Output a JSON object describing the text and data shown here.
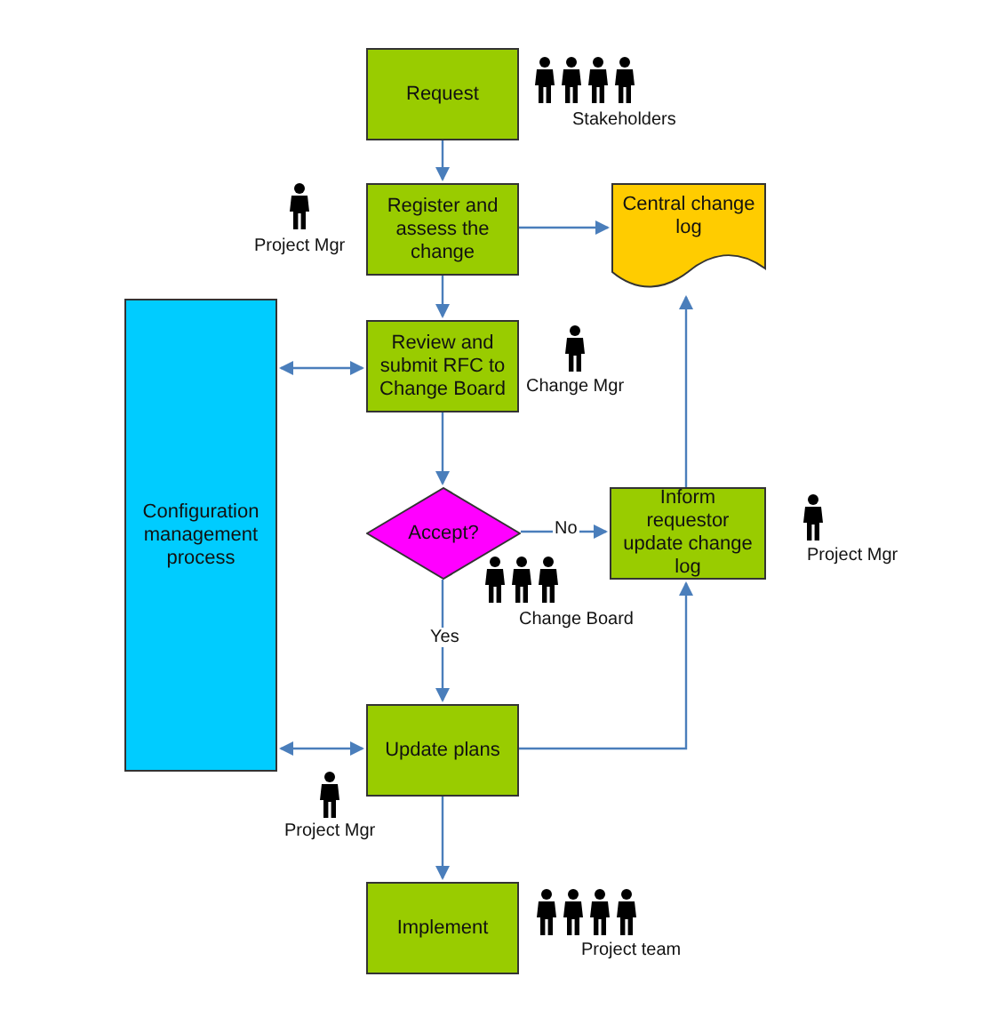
{
  "nodes": [
    {
      "kind": "process",
      "text": "Request"
    },
    {
      "kind": "process",
      "text": "Register and assess the change"
    },
    {
      "kind": "document",
      "text": "Central change log"
    },
    {
      "kind": "process",
      "text": "Review and submit RFC to Change Board"
    },
    {
      "kind": "side",
      "text": "Configuration management process"
    },
    {
      "kind": "decision",
      "text": "Accept?"
    },
    {
      "kind": "process",
      "text": "Inform requestor update change log"
    },
    {
      "kind": "process",
      "text": "Update plans"
    },
    {
      "kind": "process",
      "text": "Implement"
    }
  ],
  "roles": [
    {
      "text": "Stakeholders"
    },
    {
      "text": "Project Mgr"
    },
    {
      "text": "Change Mgr"
    },
    {
      "text": "Change Board"
    },
    {
      "text": "Project Mgr"
    },
    {
      "text": "Project Mgr"
    },
    {
      "text": "Project team"
    }
  ],
  "edge_labels": [
    {
      "text": "No"
    },
    {
      "text": "Yes"
    }
  ]
}
